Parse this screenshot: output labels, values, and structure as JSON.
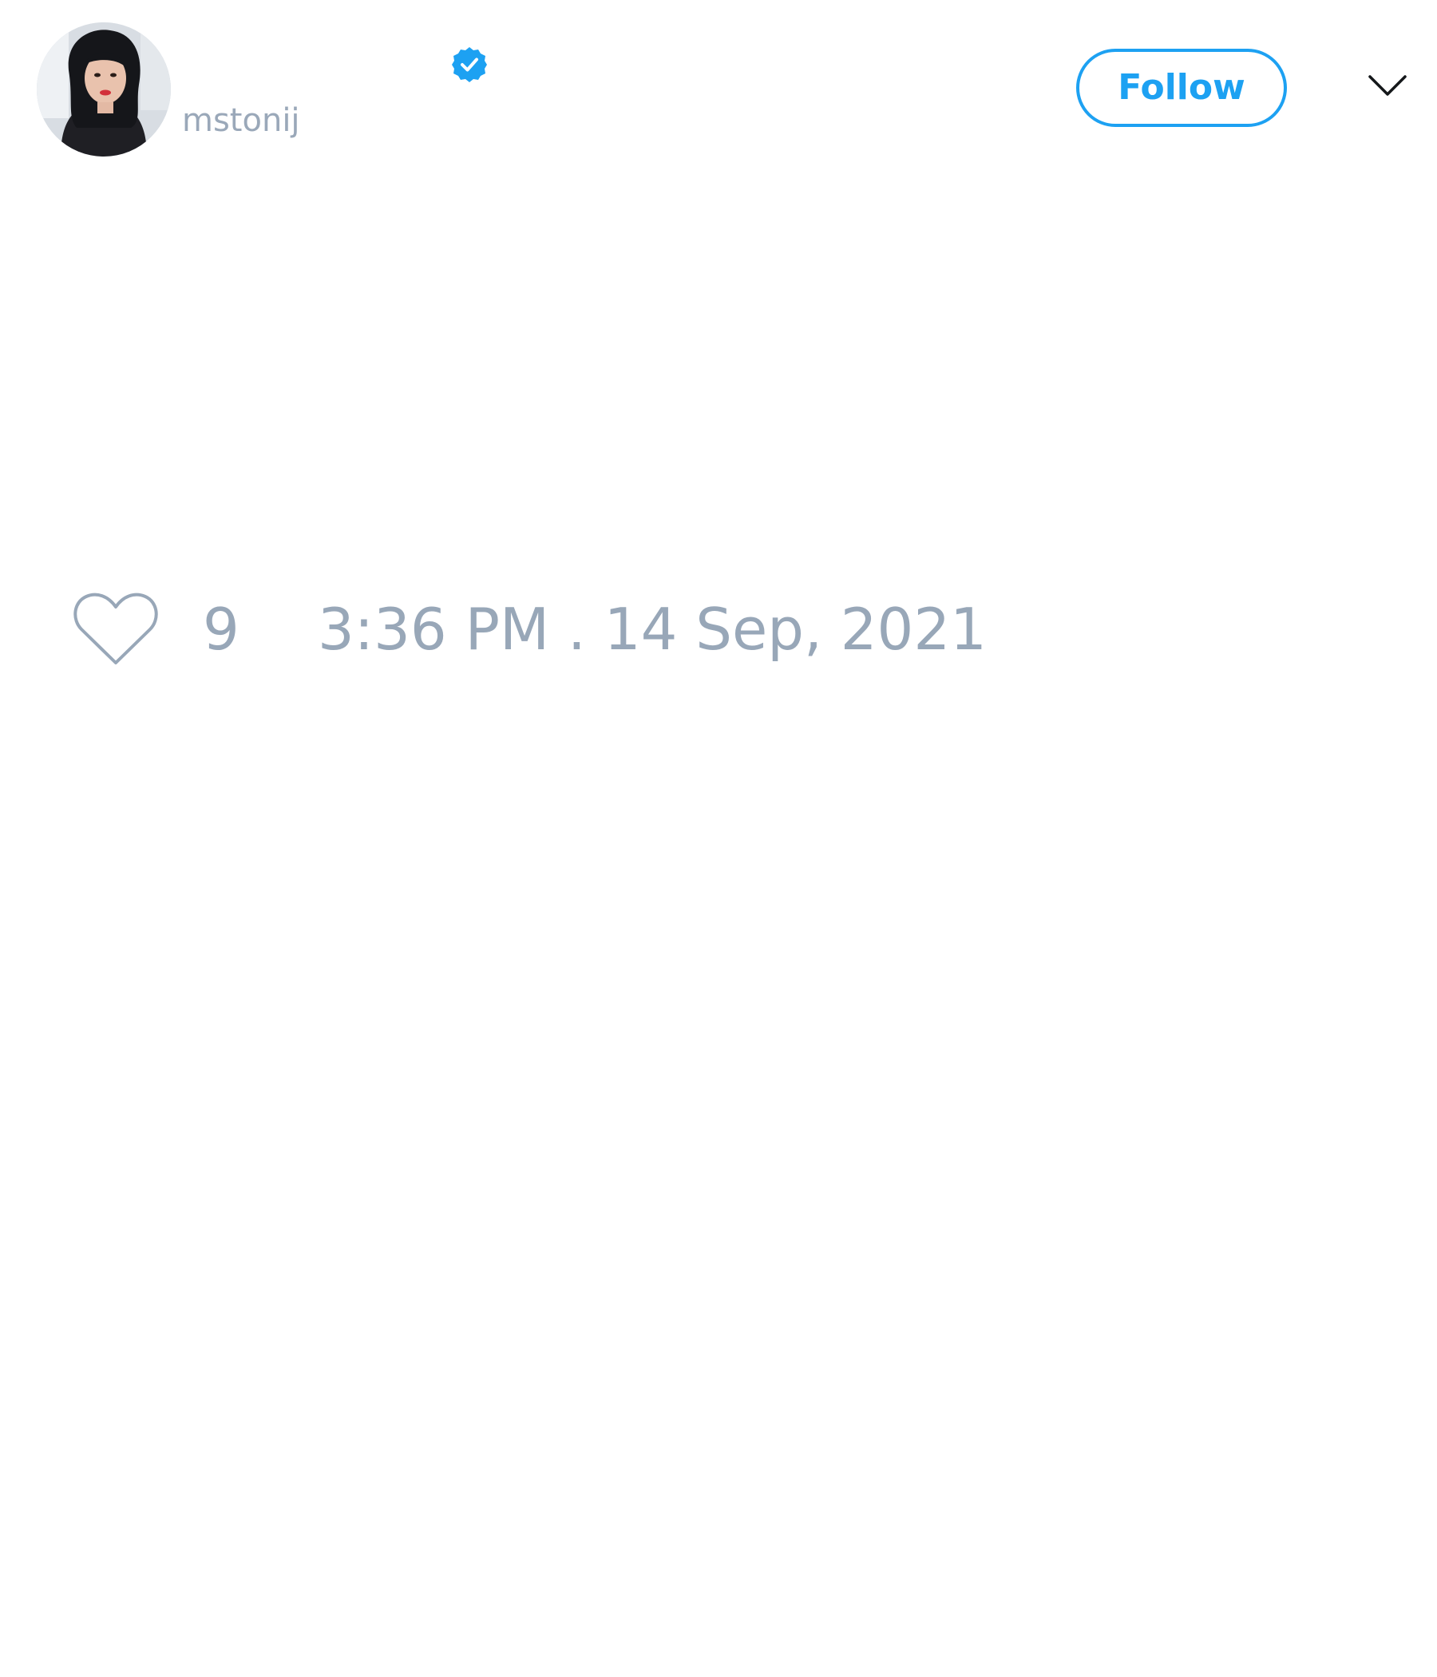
{
  "tweet": {
    "author": {
      "display_name": "",
      "handle": "mstonij",
      "verified": true,
      "avatar_icon": "user-avatar-photo"
    },
    "follow_label": "Follow",
    "menu_icon": "chevron-down-icon",
    "likes": {
      "icon": "heart-icon",
      "count": "9"
    },
    "timestamp": "3:36 PM . 14 Sep, 2021"
  },
  "colors": {
    "accent": "#1da1f2",
    "muted_text": "#98a7b8",
    "background": "#ffffff"
  }
}
